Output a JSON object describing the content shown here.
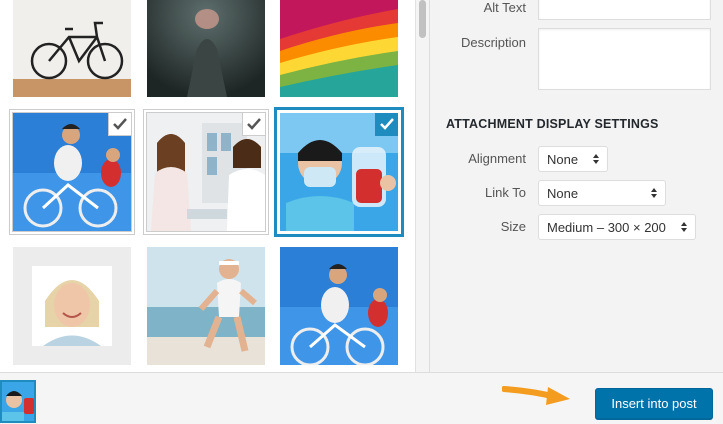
{
  "sidebar": {
    "alt_text_label": "Alt Text",
    "description_label": "Description",
    "section_title": "ATTACHMENT DISPLAY SETTINGS",
    "alignment_label": "Alignment",
    "alignment_value": "None",
    "link_to_label": "Link To",
    "link_to_value": "None",
    "size_label": "Size",
    "size_value": "Medium – 300 × 200"
  },
  "footer": {
    "insert_button": "Insert into post"
  },
  "colors": {
    "accent": "#1e8cbe",
    "button": "#0073aa",
    "arrow": "#f39c1f"
  },
  "grid": {
    "items": [
      {
        "name": "bicycle-wall",
        "selected": false
      },
      {
        "name": "pointing-finger",
        "selected": false
      },
      {
        "name": "rainbow-paper",
        "selected": false
      },
      {
        "name": "cyclists-1",
        "selected": true
      },
      {
        "name": "doctor-patient",
        "selected": true
      },
      {
        "name": "nurse-blood-bag",
        "selected": true,
        "current": true
      },
      {
        "name": "smiling-woman",
        "selected": false
      },
      {
        "name": "beach-runner",
        "selected": false
      },
      {
        "name": "cyclists-2",
        "selected": false
      }
    ]
  }
}
